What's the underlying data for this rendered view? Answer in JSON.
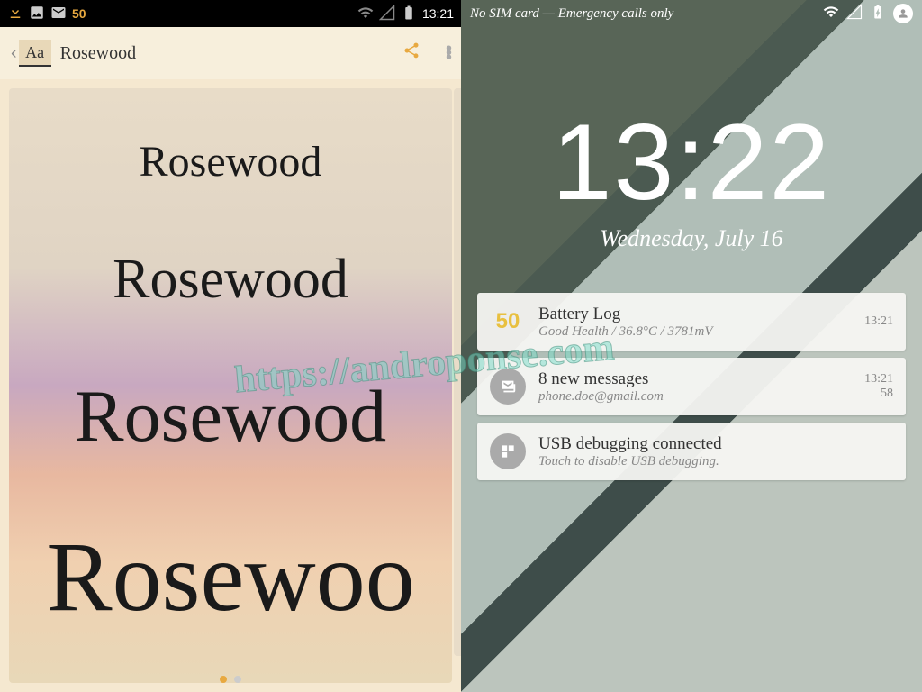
{
  "left": {
    "status": {
      "notif_count": "50",
      "time": "13:21"
    },
    "header": {
      "aa": "Aa",
      "font_name": "Rosewood"
    },
    "samples": [
      "Rosewood",
      "Rosewood",
      "Rosewood",
      "Rosewoo"
    ]
  },
  "right": {
    "status": {
      "sim_text": "No SIM card — Emergency calls only"
    },
    "clock": {
      "time": "13:22",
      "date": "Wednesday, July 16"
    },
    "notifications": [
      {
        "icon_text": "50",
        "title": "Battery Log",
        "subtitle": "Good Health / 36.8°C / 3781mV",
        "time": "13:21",
        "count": ""
      },
      {
        "title": "8 new messages",
        "subtitle": "phone.doe@gmail.com",
        "time": "13:21",
        "count": "58"
      },
      {
        "title": "USB debugging connected",
        "subtitle": "Touch to disable USB debugging.",
        "time": "",
        "count": ""
      }
    ]
  },
  "watermark": "https://androponse.com"
}
